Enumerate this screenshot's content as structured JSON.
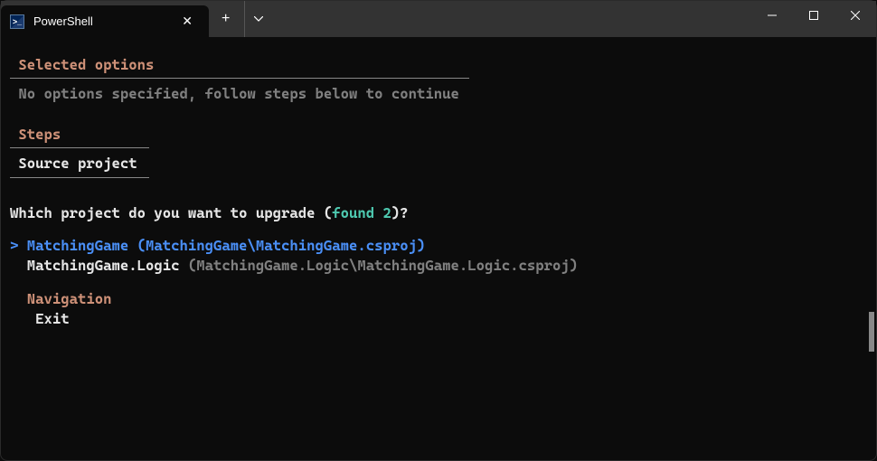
{
  "window": {
    "tab_title": "PowerShell"
  },
  "selected_options": {
    "header": "Selected options",
    "message": "No options specified, follow steps below to continue"
  },
  "steps": {
    "header": "Steps",
    "item1": "Source project"
  },
  "prompt": {
    "prefix": "Which project do you want to upgrade ",
    "found_open": "(",
    "found_text": "found 2",
    "found_close": ")",
    "suffix": "?"
  },
  "options": {
    "caret": "> ",
    "opt1_name": "MatchingGame ",
    "opt1_path": "(MatchingGame\\MatchingGame.csproj)",
    "opt2_name": "MatchingGame.Logic ",
    "opt2_path": "(MatchingGame.Logic\\MatchingGame.Logic.csproj)"
  },
  "navigation": {
    "header": "Navigation",
    "exit": "Exit"
  }
}
